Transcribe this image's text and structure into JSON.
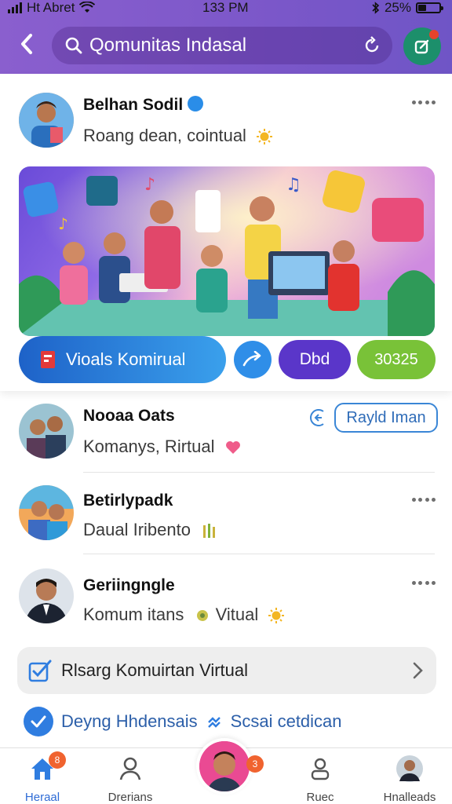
{
  "status_bar": {
    "carrier": "Ht Abret",
    "time": "133 PM",
    "battery": "25%"
  },
  "header": {
    "search_text": "Qomunitas Indasal"
  },
  "post": {
    "author": "Belhan Sodil",
    "subtitle": "Roang dean, cointual",
    "actions": {
      "primary": "Vioals Komirual",
      "secondary": "Dbd",
      "tertiary": "30325"
    }
  },
  "list": [
    {
      "name": "Nooaa Oats",
      "subtitle": "Komanys, Rirtual",
      "follow_label": "Rayld Iman"
    },
    {
      "name": "Betirlypadk",
      "subtitle": "Daual Iribento"
    },
    {
      "name": "Geriingngle",
      "subtitle": "Komum itans",
      "subtitle_suffix": "Vitual"
    }
  ],
  "group_card": {
    "label": "Rlsarg Komuirtan Virtual"
  },
  "invite": {
    "text_a": "Deyng Hhdensais",
    "text_b": "Scsai cetdican"
  },
  "nav": {
    "items": [
      {
        "label": "Heraal",
        "badge": "8"
      },
      {
        "label": "Drerians"
      },
      {
        "label": "",
        "badge": "3"
      },
      {
        "label": "Ruec"
      },
      {
        "label": "Hnalleads"
      }
    ]
  },
  "colors": {
    "header": "#7b57c9",
    "accent": "#2f6cd6",
    "green": "#79c238",
    "purple": "#5a36c9"
  }
}
